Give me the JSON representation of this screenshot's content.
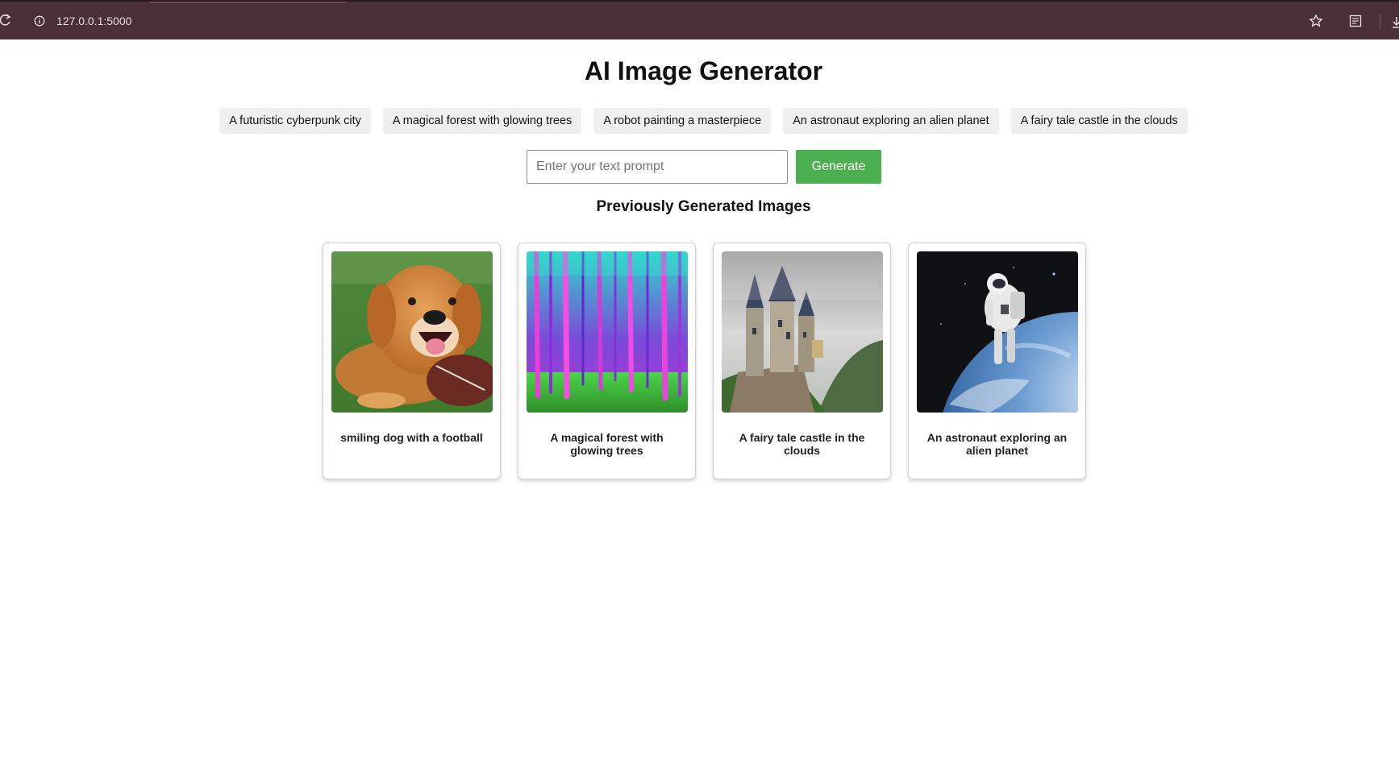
{
  "browser": {
    "url": "127.0.0.1:5000"
  },
  "page": {
    "title": "AI Image Generator"
  },
  "suggestions": [
    "A futuristic cyberpunk city",
    "A magical forest with glowing trees",
    "A robot painting a masterpiece",
    "An astronaut exploring an alien planet",
    "A fairy tale castle in the clouds"
  ],
  "form": {
    "placeholder": "Enter your text prompt",
    "value": "",
    "generate_label": "Generate"
  },
  "gallery": {
    "title": "Previously Generated Images",
    "items": [
      {
        "caption": "smiling dog with a football"
      },
      {
        "caption": "A magical forest with glowing trees"
      },
      {
        "caption": "A fairy tale castle in the clouds"
      },
      {
        "caption": "An astronaut exploring an alien planet"
      }
    ]
  },
  "colors": {
    "browser_bar": "#4b2f38",
    "generate_button": "#4caf50",
    "chip_background": "#efefef"
  },
  "icons": [
    "reload-icon",
    "info-icon",
    "star-icon",
    "reader-mode-icon",
    "download-icon"
  ]
}
